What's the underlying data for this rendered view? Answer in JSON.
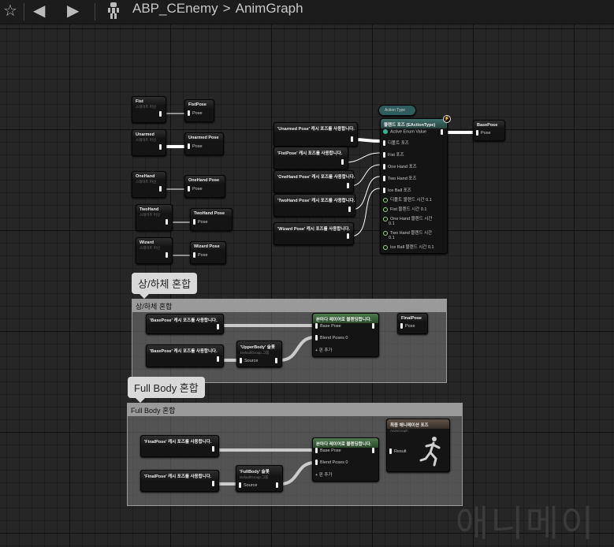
{
  "toolbar": {
    "breadcrumb_asset": "ABP_CEnemy",
    "breadcrumb_separator": ">",
    "breadcrumb_graph": "AnimGraph"
  },
  "cache_nodes": [
    {
      "title": "Fist",
      "sub": "스테이트 머신",
      "pose_title": "FistPose",
      "pin": "Pose"
    },
    {
      "title": "Unarmed",
      "sub": "스테이트 머신",
      "pose_title": "Unarmed Pose",
      "pin": "Pose"
    },
    {
      "title": "OneHand",
      "sub": "스테이트 머신",
      "pose_title": "OneHand Pose",
      "pin": "Pose"
    },
    {
      "title": "TwoHand",
      "sub": "스테이트 머신",
      "pose_title": "TwoHand Pose",
      "pin": "Pose"
    },
    {
      "title": "Wizard",
      "sub": "스테이트 머신",
      "pose_title": "Wizard Pose",
      "pin": "Pose"
    }
  ],
  "use_cached": [
    "'Unarmed Pose' 캐시 포즈를 사용합니다.",
    "'FistPose' 캐시 포즈를 사용합니다.",
    "'OneHand Pose' 캐시 포즈를 사용합니다.",
    "'TwoHand Pose' 캐시 포즈를 사용합니다.",
    "'Wizard Pose' 캐시 포즈를 사용합니다."
  ],
  "blend_enum": {
    "var_label": "Action Type",
    "title": "블렌드 포즈 (EActionType)",
    "enum_pin": "Active Enum Value",
    "pose_pins": [
      "디폴트 포즈",
      "Fist 포즈",
      "One Hand 포즈",
      "Two Hand 포즈",
      "Ice Ball 포즈"
    ],
    "time_pins": [
      "디폴트 블렌드 시간",
      "Fist 블렌드 시간",
      "One Hand 블렌드 시간",
      "Two Hand 블렌드 시간",
      "Ice Ball 블렌드 시간"
    ],
    "time_value": "0.1"
  },
  "base_pose": {
    "title": "BasePose",
    "pin": "Pose"
  },
  "comment1": {
    "bubble": "상/하체 혼합",
    "title": "상/하체 혼합",
    "use1": "'BasePose' 캐시 포즈를 사용합니다.",
    "use2": "'BasePose' 캐시 포즈를 사용합니다.",
    "slot_title": "'UpperBody' 슬롯",
    "slot_sub": "DefaultGroup.그룹",
    "slot_pin": "Source",
    "layer_title": "본마다 레이어로 블렌딩합니다.",
    "layer_pins": [
      "Base Pose",
      "Blend Poses 0",
      "핀 추가"
    ],
    "final_title": "FinalPose",
    "final_pin": "Pose"
  },
  "comment2": {
    "bubble": "Full Body 혼합",
    "title": "Full Body 혼합",
    "use1": "'FinalPose' 캐시 포즈를 사용합니다.",
    "use2": "'FinalPose' 캐시 포즈를 사용합니다.",
    "slot_title": "'FullBody' 슬롯",
    "slot_sub": "DefaultGroup.그룹",
    "slot_pin": "Source",
    "layer_title": "본마다 레이어로 블렌딩합니다.",
    "layer_pins": [
      "Base Pose",
      "Blend Poses 0",
      "핀 추가"
    ],
    "output_title": "최종 애니메이션 포즈",
    "output_sub": "AnimGraph",
    "output_pin": "Result"
  },
  "watermark": "애니메이"
}
